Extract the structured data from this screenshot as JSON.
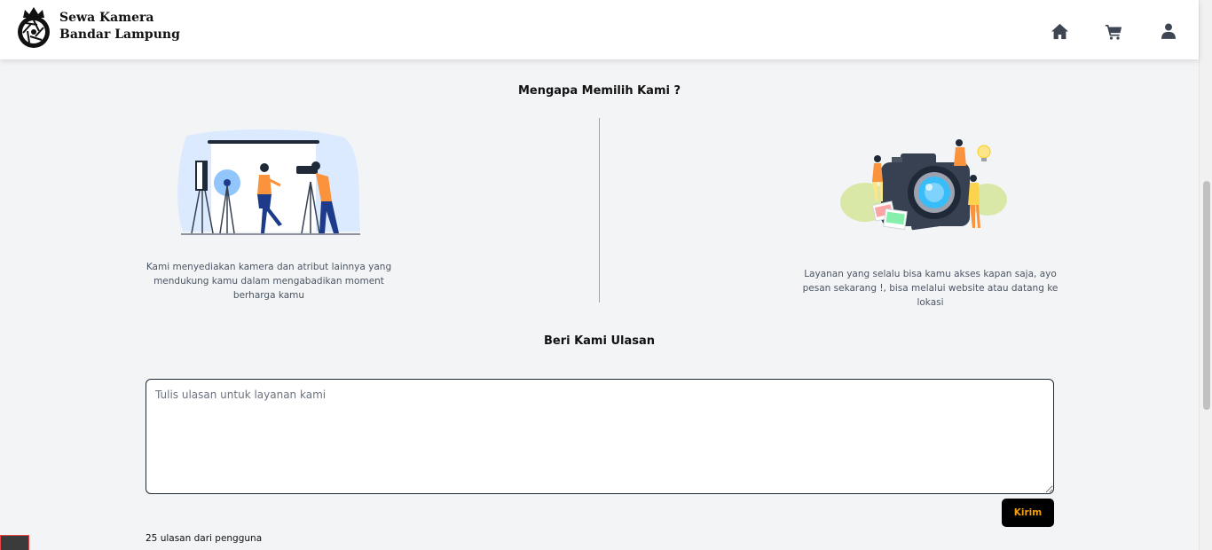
{
  "brand": {
    "line1": "Sewa Kamera",
    "line2": "Bandar Lampung"
  },
  "nav": {
    "items": [
      {
        "icon": "home-icon",
        "label": "Home"
      },
      {
        "icon": "cart-icon",
        "label": "Cart"
      },
      {
        "icon": "user-icon",
        "label": "Account"
      }
    ],
    "icon_color": "#3f4653"
  },
  "why": {
    "title": "Mengapa Memilih Kami ?",
    "features": [
      {
        "illustration": "photo-studio-illustration",
        "text": "Kami menyediakan kamera dan atribut lainnya yang mendukung kamu dalam mengabadikan moment berharga kamu"
      },
      {
        "illustration": "camera-team-illustration",
        "text": "Layanan yang selalu bisa kamu akses kapan saja, ayo pesan sekarang !, bisa melalui website atau datang ke lokasi"
      }
    ]
  },
  "review": {
    "title": "Beri Kami Ulasan",
    "placeholder": "Tulis ulasan untuk layanan kami",
    "value": "",
    "submit_label": "Kirim",
    "count_text": "25 ulasan dari pengguna"
  },
  "colors": {
    "accent": "#f59e0b",
    "button_bg": "#000000",
    "background": "#f3f4f6",
    "illustration_orange": "#fb923c",
    "illustration_blue": "#bfdbfe"
  }
}
